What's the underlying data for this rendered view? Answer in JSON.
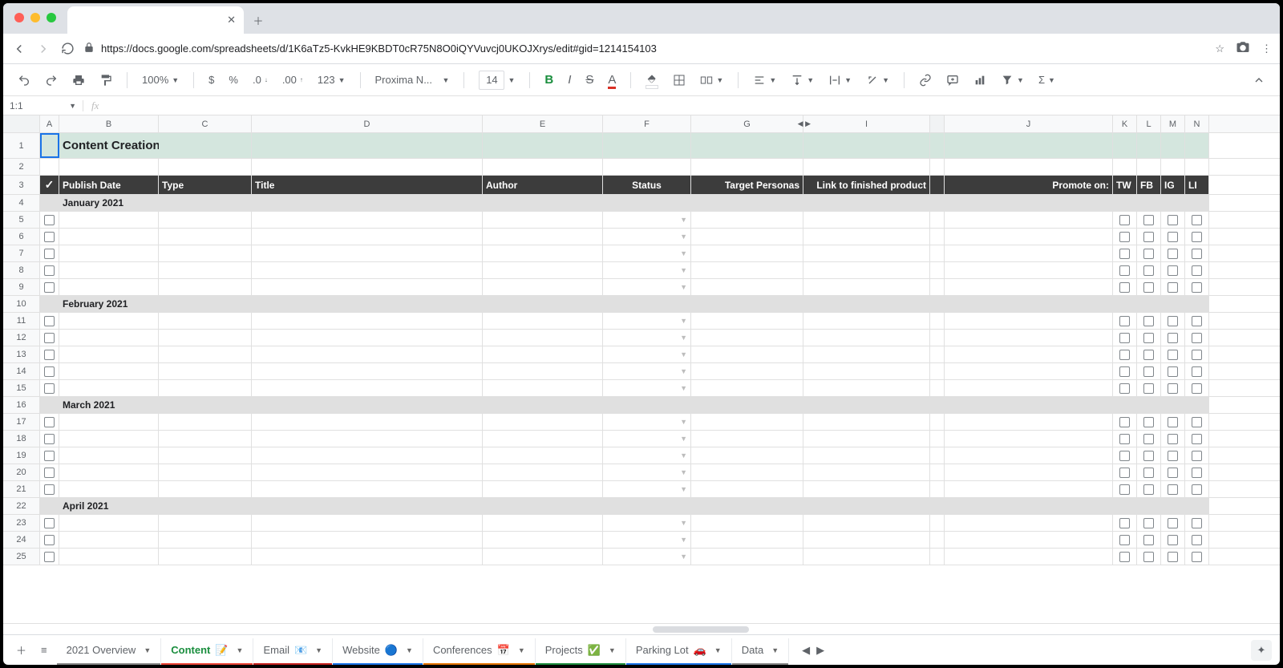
{
  "browser": {
    "tab_title": "",
    "url": "https://docs.google.com/spreadsheets/d/1K6aTz5-KvkHE9KBDT0cR75N8O0iQYVuvcj0UKOJXrys/edit#gid=1214154103"
  },
  "toolbar": {
    "zoom": "100%",
    "number_format": "123",
    "font_name": "Proxima N...",
    "font_size": "14"
  },
  "namebox": "1:1",
  "fx_value": "",
  "columns": [
    "A",
    "B",
    "C",
    "D",
    "E",
    "F",
    "G",
    "I",
    "J",
    "K",
    "L",
    "M",
    "N"
  ],
  "title_row": "Content Creation (Blog / Social)",
  "header_row": {
    "check": "✓",
    "B": "Publish Date",
    "C": "Type",
    "D": "Title",
    "E": "Author",
    "F": "Status",
    "G": "Target Personas",
    "I": "Link to finished product",
    "J": "Promote on:",
    "K": "TW",
    "L": "FB",
    "M": "IG",
    "N": "LI"
  },
  "months": {
    "r4": "January 2021",
    "r10": "February 2021",
    "r16": "March 2021",
    "r22": "April 2021"
  },
  "row_numbers": [
    "1",
    "2",
    "3",
    "4",
    "5",
    "6",
    "7",
    "8",
    "9",
    "10",
    "11",
    "12",
    "13",
    "14",
    "15",
    "16",
    "17",
    "18",
    "19",
    "20",
    "21",
    "22",
    "23",
    "24",
    "25"
  ],
  "sheets": [
    {
      "name": "2021 Overview",
      "color": "#888",
      "icon": ""
    },
    {
      "name": "Content",
      "color": "#ea4335",
      "icon": "📝",
      "active": true
    },
    {
      "name": "Email",
      "color": "#c5221f",
      "icon": "📧"
    },
    {
      "name": "Website",
      "color": "#1a73e8",
      "icon": "🔵"
    },
    {
      "name": "Conferences",
      "color": "#e37400",
      "icon": "📅"
    },
    {
      "name": "Projects",
      "color": "#1e8e3e",
      "icon": "✅"
    },
    {
      "name": "Parking Lot",
      "color": "#1a73e8",
      "icon": "🚗"
    },
    {
      "name": "Data",
      "color": "#888",
      "icon": ""
    }
  ]
}
